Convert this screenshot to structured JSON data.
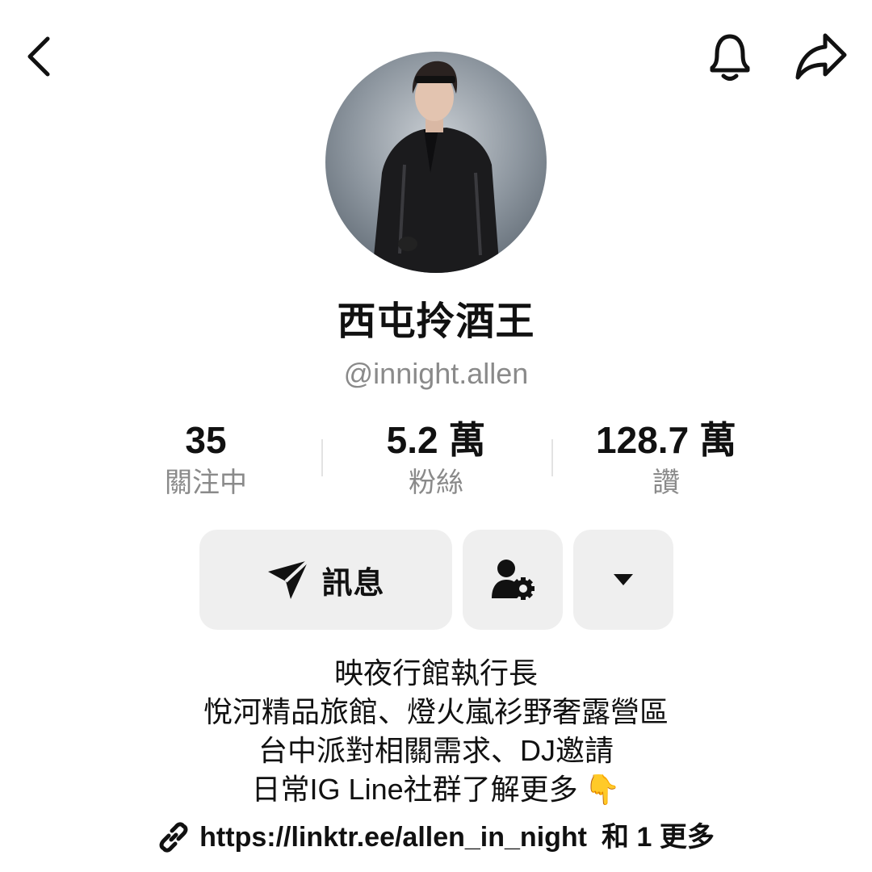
{
  "header": {
    "back_icon": "chevron-left-icon",
    "notification_icon": "bell-icon",
    "share_icon": "share-arrow-icon"
  },
  "profile": {
    "display_name": "西屯拎酒王",
    "handle": "@innight.allen",
    "avatar_icon": "profile-photo"
  },
  "stats": [
    {
      "value": "35",
      "label": "關注中"
    },
    {
      "value": "5.2 萬",
      "label": "粉絲"
    },
    {
      "value": "128.7 萬",
      "label": "讚"
    }
  ],
  "actions": {
    "message_label": "訊息",
    "message_icon": "send-icon",
    "follow_settings_icon": "person-gear-icon",
    "more_icon": "caret-down-icon"
  },
  "bio": {
    "lines": [
      "映夜行館執行長",
      "悅河精品旅館、燈火嵐衫野奢露營區",
      "台中派對相關需求、DJ邀請",
      "日常IG  Line社群了解更多"
    ],
    "emoji": "👇"
  },
  "link": {
    "icon": "link-icon",
    "url_text": "https://linktr.ee/allen_in_night",
    "more_text": "和 1 更多"
  },
  "colors": {
    "secondary_text": "#8a8a8a",
    "button_bg": "#efefef",
    "primary_text": "#111111"
  }
}
